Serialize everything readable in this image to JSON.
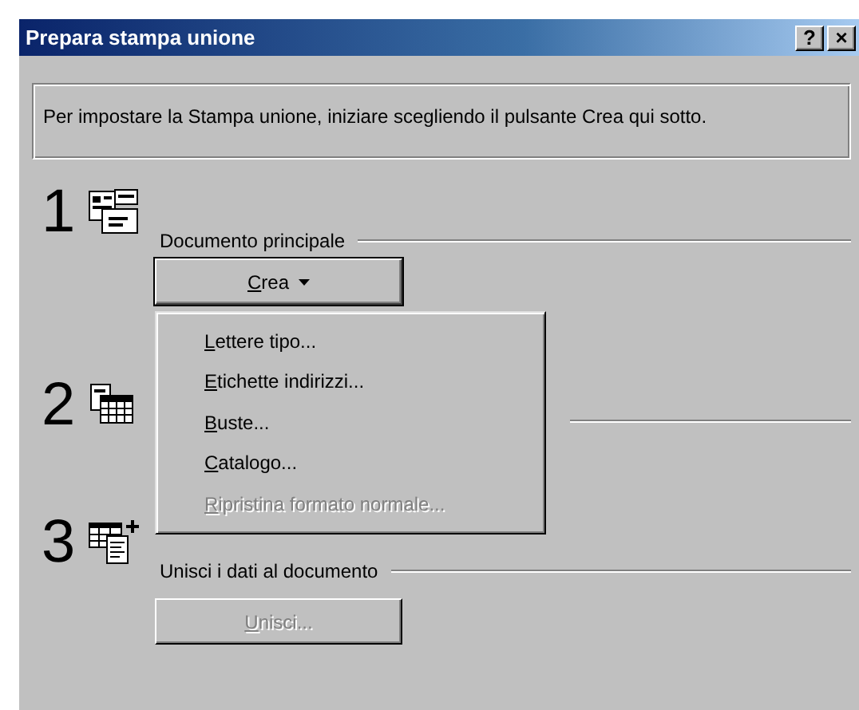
{
  "window": {
    "title": "Prepara stampa unione",
    "title_buttons": [
      "?",
      "×"
    ]
  },
  "intro": "Per impostare la Stampa unione, iniziare scegliendo il pulsante Crea qui sotto.",
  "steps": [
    {
      "number": "1",
      "label": "Documento principale",
      "button": {
        "label": "Crea",
        "disabled": false,
        "dropdown": true,
        "focused": true
      }
    },
    {
      "number": "2"
    },
    {
      "number": "3",
      "label": "Unisci i dati al documento",
      "button": {
        "label": "Unisci...",
        "disabled": true,
        "dropdown": false,
        "focused": false
      }
    }
  ],
  "menu": {
    "items": [
      {
        "label": "Lettere tipo...",
        "disabled": false
      },
      {
        "label": "Etichette indirizzi...",
        "disabled": false
      },
      {
        "label": "Buste...",
        "disabled": false
      },
      {
        "label": "Catalogo...",
        "disabled": false
      },
      {
        "label": "Ripristina formato normale...",
        "disabled": true
      }
    ]
  }
}
